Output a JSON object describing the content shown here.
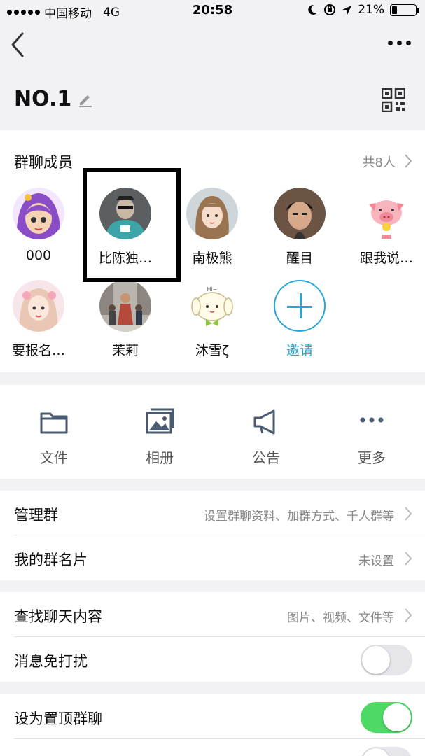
{
  "status_bar": {
    "carrier": "中国移动",
    "network": "4G",
    "time": "20:58",
    "battery": "21%",
    "battery_level": 0.21
  },
  "header": {
    "group_name": "NO.1"
  },
  "members": {
    "title": "群聊成员",
    "count": "共8人",
    "items": [
      {
        "name": "000"
      },
      {
        "name": "比陈独…"
      },
      {
        "name": "南极熊"
      },
      {
        "name": "醒目"
      },
      {
        "name": "跟我说…"
      },
      {
        "name": "要报名…"
      },
      {
        "name": "茉莉"
      },
      {
        "name": "沐雪ζ"
      }
    ],
    "invite_label": "邀请"
  },
  "tools": [
    {
      "label": "文件",
      "icon": "folder-icon"
    },
    {
      "label": "相册",
      "icon": "photo-album-icon"
    },
    {
      "label": "公告",
      "icon": "megaphone-icon"
    },
    {
      "label": "更多",
      "icon": "more-dots-icon"
    }
  ],
  "settings": {
    "manage_group": {
      "title": "管理群",
      "value": "设置群聊资料、加群方式、千人群等"
    },
    "my_card": {
      "title": "我的群名片",
      "value": "未设置"
    },
    "search_chat": {
      "title": "查找聊天内容",
      "value": "图片、视频、文件等"
    },
    "do_not_disturb": {
      "title": "消息免打扰",
      "on": false
    },
    "pin_to_top": {
      "title": "设为置顶群聊",
      "on": true
    }
  },
  "colors": {
    "accent": "#2aa6d6",
    "toggle_on": "#4cd964",
    "toggle_off": "#e5e5ea"
  }
}
